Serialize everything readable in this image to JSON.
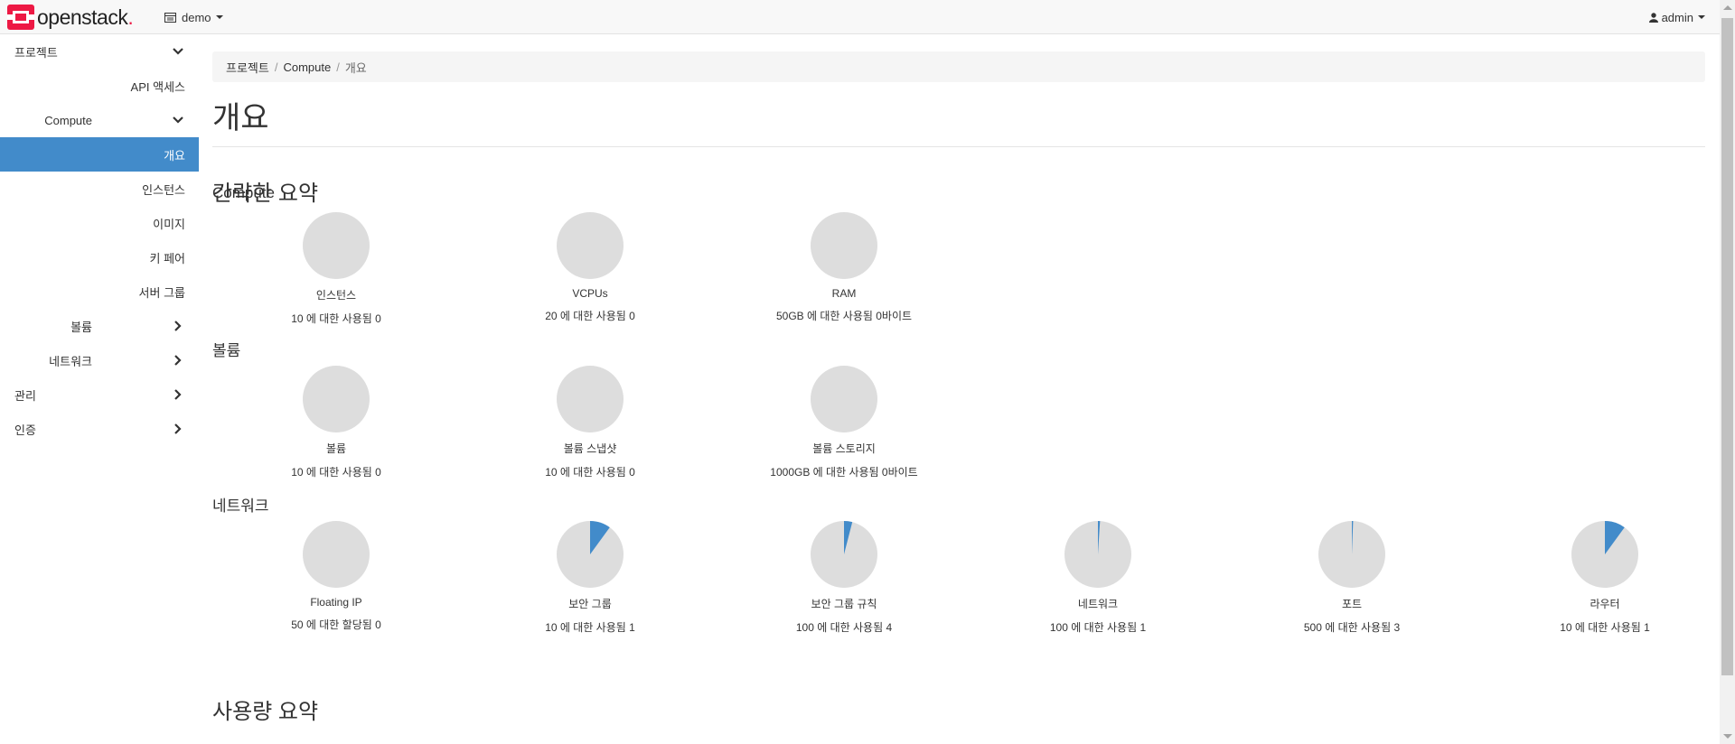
{
  "header": {
    "brand": "openstack",
    "brand_dot": ".",
    "project": "demo",
    "user": "admin"
  },
  "sidebar": {
    "items": [
      {
        "label": "프로젝트",
        "level": 0,
        "chevron": "down",
        "active": false
      },
      {
        "label": "API 액세스",
        "level": 2,
        "chevron": "",
        "active": false
      },
      {
        "label": "Compute",
        "level": 1,
        "chevron": "down",
        "active": false
      },
      {
        "label": "개요",
        "level": 2,
        "chevron": "",
        "active": true
      },
      {
        "label": "인스턴스",
        "level": 2,
        "chevron": "",
        "active": false
      },
      {
        "label": "이미지",
        "level": 2,
        "chevron": "",
        "active": false
      },
      {
        "label": "키 페어",
        "level": 2,
        "chevron": "",
        "active": false
      },
      {
        "label": "서버 그룹",
        "level": 2,
        "chevron": "",
        "active": false
      },
      {
        "label": "볼륨",
        "level": 1,
        "chevron": "right",
        "active": false
      },
      {
        "label": "네트워크",
        "level": 1,
        "chevron": "right",
        "active": false
      },
      {
        "label": "관리",
        "level": 0,
        "chevron": "right",
        "active": false
      },
      {
        "label": "인증",
        "level": 0,
        "chevron": "right",
        "active": false
      }
    ]
  },
  "breadcrumb": [
    "프로젝트",
    "Compute",
    "개요"
  ],
  "page_title": "개요",
  "summary_heading": "간략한 요약",
  "usage_heading": "사용량 요약",
  "colors": {
    "pie_bg": "#dddddd",
    "pie_fill": "#428bca",
    "active": "#428bca"
  },
  "groups": [
    {
      "title": "Compute",
      "charts": [
        {
          "title": "인스턴스",
          "sub": "10 에 대한 사용됨 0",
          "used": 0,
          "limit": 10
        },
        {
          "title": "VCPUs",
          "sub": "20 에 대한 사용됨 0",
          "used": 0,
          "limit": 20
        },
        {
          "title": "RAM",
          "sub": "50GB 에 대한 사용됨 0바이트",
          "used": 0,
          "limit": 50
        }
      ]
    },
    {
      "title": "볼륨",
      "charts": [
        {
          "title": "볼륨",
          "sub": "10 에 대한 사용됨 0",
          "used": 0,
          "limit": 10
        },
        {
          "title": "볼륨 스냅샷",
          "sub": "10 에 대한 사용됨 0",
          "used": 0,
          "limit": 10
        },
        {
          "title": "볼륨 스토리지",
          "sub": "1000GB 에 대한 사용됨 0바이트",
          "used": 0,
          "limit": 1000
        }
      ]
    },
    {
      "title": "네트워크",
      "charts": [
        {
          "title": "Floating IP",
          "sub": "50 에 대한 할당됨 0",
          "used": 0,
          "limit": 50
        },
        {
          "title": "보안 그룹",
          "sub": "10 에 대한 사용됨 1",
          "used": 1,
          "limit": 10
        },
        {
          "title": "보안 그룹 규칙",
          "sub": "100 에 대한 사용됨 4",
          "used": 4,
          "limit": 100
        },
        {
          "title": "네트워크",
          "sub": "100 에 대한 사용됨 1",
          "used": 1,
          "limit": 100
        },
        {
          "title": "포트",
          "sub": "500 에 대한 사용됨 3",
          "used": 3,
          "limit": 500
        },
        {
          "title": "라우터",
          "sub": "10 에 대한 사용됨 1",
          "used": 1,
          "limit": 10
        }
      ]
    }
  ]
}
